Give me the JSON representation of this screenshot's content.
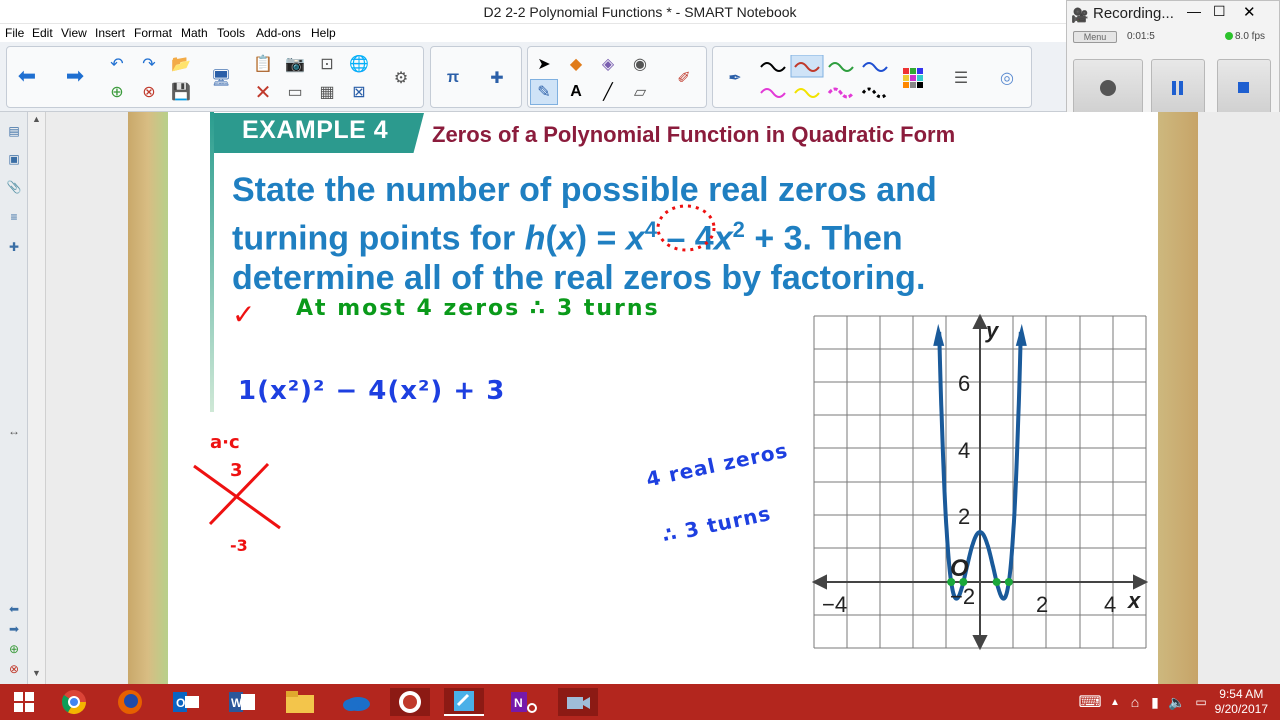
{
  "window": {
    "title": "D2 2-2 Polynomial Functions * - SMART Notebook"
  },
  "menu": [
    "File",
    "Edit",
    "View",
    "Insert",
    "Format",
    "Math",
    "Tools",
    "Add-ons",
    "Help"
  ],
  "recorder": {
    "title": "Recording...",
    "menu_label": "Menu",
    "time": "0:01:5",
    "fps": "8.0 fps"
  },
  "lesson": {
    "example_label": "EXAMPLE 4",
    "example_title": "Zeros of a Polynomial Function in Quadratic Form",
    "problem_line1": "State the number of possible real zeros and",
    "problem_line2_a": "turning points for ",
    "problem_line2_h": "h",
    "problem_line2_b": "(",
    "problem_line2_x": "x",
    "problem_line2_c": ") = ",
    "problem_line2_x4": "x",
    "problem_line2_sup4": "4",
    "problem_line2_d": " – 4",
    "problem_line2_x2": "x",
    "problem_line2_sup2": "2",
    "problem_line2_e": " + 3. Then",
    "problem_line3": "determine all of the real zeros by factoring."
  },
  "handwriting": {
    "check": "✓",
    "green_note": "At most 4 zeros  ∴  3 turns",
    "blue_expr": "1(x²)² − 4(x²) + 3",
    "ac_label": "a·c",
    "ac_top": "3",
    "ac_bottom": "-3",
    "blue_note1": "4 real zeros",
    "blue_note2": "∴ 3 turns"
  },
  "graph": {
    "x_ticks": [
      "−4",
      "−2",
      "2",
      "4"
    ],
    "y_ticks": [
      "2",
      "4",
      "6"
    ],
    "x_label": "x",
    "y_label": "y",
    "origin_label": "O"
  },
  "taskbar": {
    "time": "9:54 AM",
    "date": "9/20/2017"
  }
}
